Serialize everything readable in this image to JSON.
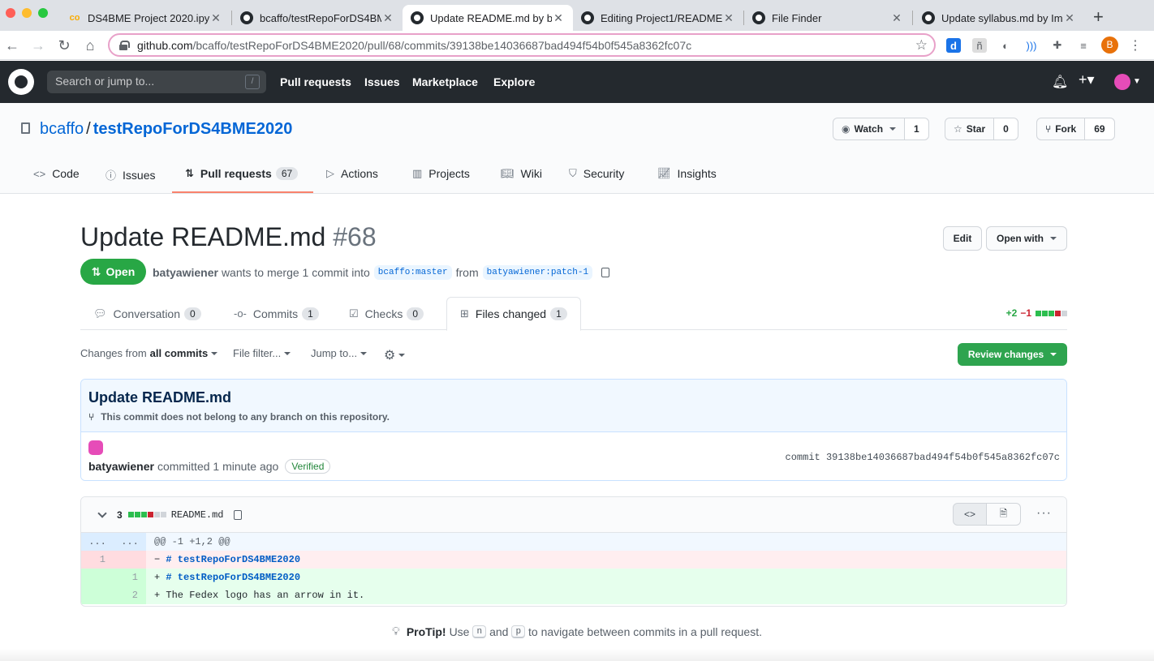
{
  "browser": {
    "tabs": [
      {
        "title": "DS4BME Project 2020.ipy",
        "favicon": "colab-icon"
      },
      {
        "title": "bcaffo/testRepoForDS4BM",
        "favicon": "github-icon"
      },
      {
        "title": "Update README.md by b",
        "favicon": "github-icon"
      },
      {
        "title": "Editing Project1/README.",
        "favicon": "github-icon"
      },
      {
        "title": "File Finder",
        "favicon": "github-icon"
      },
      {
        "title": "Update syllabus.md by Im",
        "favicon": "github-icon"
      }
    ],
    "url_host": "github.com",
    "url_path": "/bcaffo/testRepoForDS4BME2020/pull/68/commits/39138be14036687bad494f54b0f545a8362fc07c",
    "profile_initial": "B"
  },
  "gh_header": {
    "search_placeholder": "Search or jump to...",
    "slash_key": "/",
    "nav": [
      "Pull requests",
      "Issues",
      "Marketplace",
      "Explore"
    ]
  },
  "repo": {
    "owner": "bcaffo",
    "name": "testRepoForDS4BME2020",
    "watch_label": "Watch",
    "watch_count": "1",
    "star_label": "Star",
    "star_count": "0",
    "fork_label": "Fork",
    "fork_count": "69",
    "nav": {
      "code": "Code",
      "issues": "Issues",
      "pulls": "Pull requests",
      "pulls_count": "67",
      "actions": "Actions",
      "projects": "Projects",
      "wiki": "Wiki",
      "security": "Security",
      "insights": "Insights"
    }
  },
  "pr": {
    "title": "Update README.md",
    "number": "#68",
    "edit_label": "Edit",
    "open_with_label": "Open with",
    "state": "Open",
    "author": "batyawiener",
    "merge_text": "wants to merge 1 commit into",
    "base_branch": "bcaffo:master",
    "from_text": "from",
    "head_branch": "batyawiener:patch-1",
    "tabs": {
      "conversation": "Conversation",
      "conversation_count": "0",
      "commits": "Commits",
      "commits_count": "1",
      "checks": "Checks",
      "checks_count": "0",
      "files": "Files changed",
      "files_count": "1"
    },
    "additions": "+2",
    "deletions": "−1"
  },
  "toolbar": {
    "changes_from": "Changes from",
    "all_commits": "all commits",
    "file_filter": "File filter...",
    "jump_to": "Jump to...",
    "review_changes": "Review changes"
  },
  "commit": {
    "title": "Update README.md",
    "note": "This commit does not belong to any branch on this repository.",
    "author": "batyawiener",
    "committed_text": "committed 1 minute ago",
    "verified": "Verified",
    "sha_text": "commit 39138be14036687bad494f54b0f545a8362fc07c"
  },
  "file": {
    "change_count": "3",
    "name": "README.md",
    "hunk_left": "...",
    "hunk_right": "...",
    "hunk_header": "@@ -1 +1,2 @@",
    "lines": [
      {
        "old": "1",
        "new": "",
        "sign": "−",
        "heading": "# testRepoForDS4BME2020",
        "rest": ""
      },
      {
        "old": "",
        "new": "1",
        "sign": "+",
        "heading": "# testRepoForDS4BME2020",
        "rest": ""
      },
      {
        "old": "",
        "new": "2",
        "sign": "+",
        "heading": "",
        "rest": "The Fedex logo has an arrow in it."
      }
    ]
  },
  "protip": {
    "label": "ProTip!",
    "text1": "Use",
    "key_n": "n",
    "and_text": "and",
    "key_p": "p",
    "text2": "to navigate between commits in a pull request."
  }
}
